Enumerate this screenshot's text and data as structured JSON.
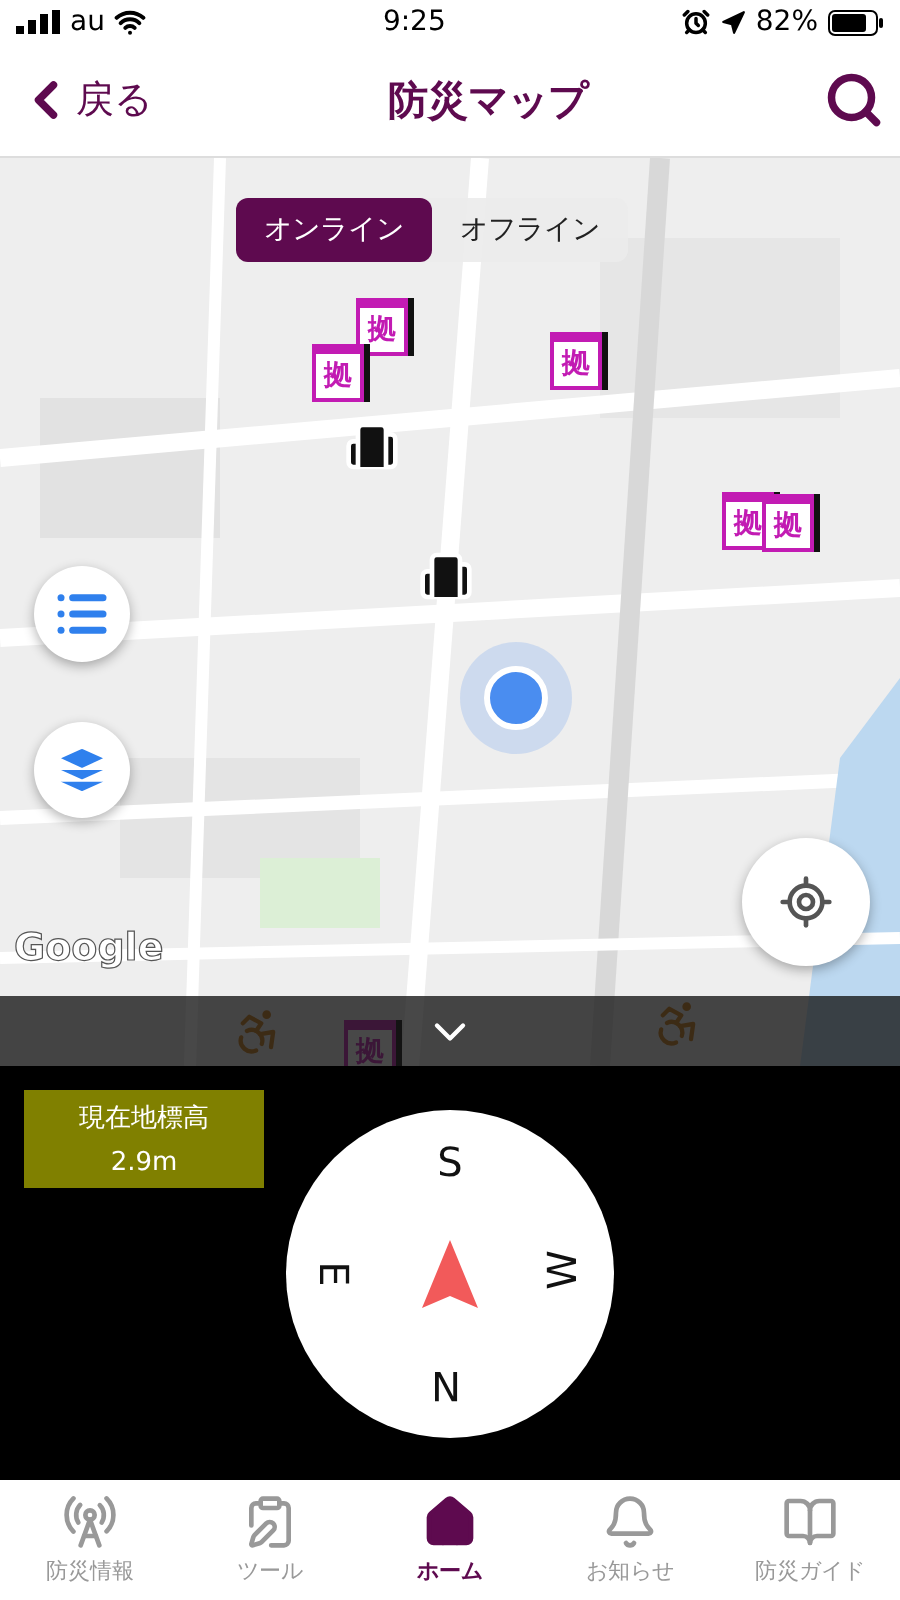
{
  "status_bar": {
    "carrier": "au",
    "time": "9:25",
    "battery": "82%"
  },
  "nav": {
    "back": "戻る",
    "title": "防災マップ"
  },
  "mode_toggle": [
    {
      "label": "オンライン",
      "selected": true
    },
    {
      "label": "オフライン",
      "selected": false
    }
  ],
  "map": {
    "attribution": "Google",
    "markers": [
      {
        "kind": "shelter",
        "label": "拠"
      },
      {
        "kind": "shelter",
        "label": "拠"
      },
      {
        "kind": "shelter",
        "label": "拠"
      },
      {
        "kind": "shelter",
        "label": "拠"
      },
      {
        "kind": "shelter",
        "label": "拠"
      },
      {
        "kind": "building"
      },
      {
        "kind": "building"
      },
      {
        "kind": "accessible"
      },
      {
        "kind": "shelter",
        "label": "拠"
      },
      {
        "kind": "accessible"
      }
    ]
  },
  "elevation": {
    "title": "現在地標高",
    "value": "2.9m"
  },
  "compass": {
    "points": [
      "S",
      "W",
      "N",
      "E"
    ]
  },
  "tabs": [
    {
      "label": "防災情報",
      "selected": false
    },
    {
      "label": "ツール",
      "selected": false
    },
    {
      "label": "ホーム",
      "selected": true
    },
    {
      "label": "お知らせ",
      "selected": false
    },
    {
      "label": "防災ガイド",
      "selected": false
    }
  ]
}
